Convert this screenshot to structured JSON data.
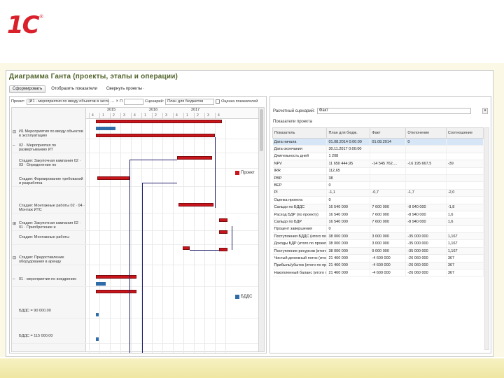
{
  "logo": {
    "text": "1С",
    "mark": "®"
  },
  "window": {
    "title": "Диаграмма Ганта (проекты, этапы и операции)"
  },
  "toolbar": {
    "btn1": "Сформировать",
    "btn2": "Отобразить показатели",
    "btn3": "Свернуть проекты ·"
  },
  "filters": {
    "f1_label": "Проект:",
    "f1_value": "(И1 - мероприятия по вводу объектов в эксплу.",
    "f2_label": "П",
    "f3_label": "Сценарий:",
    "f3_value": "План для бюджетов",
    "f4_label": "Оценка показателей"
  },
  "timeline": {
    "years": [
      "2015",
      "2016",
      "2017"
    ],
    "quarters": [
      "4",
      "1",
      "2",
      "3",
      "4",
      "1",
      "2",
      "3",
      "4",
      "1",
      "2",
      "3",
      "4"
    ]
  },
  "gantt_rows": [
    {
      "label": "И1 Мероприятия по вводу объектов в эксплуатацию",
      "exp": "⊟"
    },
    {
      "label": "02 · Мероприятия по развертыванию ИТ",
      "exp": "–"
    },
    {
      "label": "Стадия: Закупочная кампания 02 · 03 · Определение по",
      "exp": ""
    },
    {
      "label": "Стадия: Формирование требований и разработка",
      "exp": ""
    },
    {
      "label": "Стадия: Монтажные работы 02 · 04 · Монтаж ИТС",
      "exp": ""
    },
    {
      "label": "Стадия: Закупочная кампания 02 · 01 · Приобретение и",
      "exp": "⊞"
    },
    {
      "label": "Стадия: Монтажные работы",
      "exp": ""
    },
    {
      "label": "Стадия: Предоставление оборудования в аренду",
      "exp": "⊟"
    },
    {
      "label": "01 · мероприятия по внедрению",
      "exp": "–"
    },
    {
      "label": "БДДС = 90 000.00",
      "exp": ""
    },
    {
      "label": "БДДС = 115 000.00",
      "exp": ""
    }
  ],
  "legend": {
    "project": "Проект",
    "bdds": "БДДС"
  },
  "rpanel": {
    "calc_label": "Расчетный сценарий:",
    "calc_value": "Факт",
    "show_label": "Показатели проекта"
  },
  "table": {
    "headers": [
      "Показатель",
      "План для бюдж.",
      "Факт",
      "Отклонение",
      "Соотношение"
    ],
    "rows": [
      [
        "Дата начала",
        "01.08.2014 0:00:00",
        "01.08.2014",
        "0",
        ""
      ],
      [
        "Дата окончания",
        "30.11.2017 0:00:00",
        "",
        "",
        ""
      ],
      [
        "Длительность дней",
        "1 208",
        "",
        "",
        ""
      ],
      [
        "NPV",
        "11 650 444,95",
        "-14 545 762,…",
        "-16 195 667,5",
        "-39"
      ],
      [
        "IRR",
        "112,65",
        "",
        "",
        ""
      ],
      [
        "PBP",
        "38",
        "",
        "",
        ""
      ],
      [
        "BEP",
        "0",
        "",
        "",
        ""
      ],
      [
        "PI",
        "-1,1",
        "-0,7",
        "-1,7",
        "-2,0"
      ],
      [
        "Оценка проекта",
        "0",
        "",
        "",
        ""
      ],
      [
        "Сальдо по БДДС",
        "16 540 000",
        "7 600 000",
        "-8 940 000",
        "-1,8"
      ],
      [
        "Расход БДР (по проекту)",
        "16 540 000",
        "7 600 000",
        "-8 940 000",
        "1,6"
      ],
      [
        "Сальдо по БДР",
        "16 540 000",
        "7 600 000",
        "-8 940 000",
        "1,6"
      ],
      [
        "Процент завершения",
        "0",
        "",
        "",
        ""
      ],
      [
        "Поступления БДДС (итого по п…",
        "38 000 000",
        "3 000 000",
        "-35 000 000",
        "1,167"
      ],
      [
        "Доходы БДР (итого по проекту)",
        "38 000 000",
        "3 000 000",
        "-35 000 000",
        "1,167"
      ],
      [
        "Поступление ресурсов (итого по…",
        "38 000 000",
        "9 000 000",
        "-35 000 000",
        "1,167"
      ],
      [
        "Чистый денежный поток (итого…",
        "21 460 000",
        "-4 600 000",
        "-26 060 000",
        "367"
      ],
      [
        "Прибыль/убыток (итого по проек…",
        "21 460 000",
        "-4 600 000",
        "-26 060 000",
        "367"
      ],
      [
        "Накопленный баланс (итого по…",
        "21 460 000",
        "-4 600 000",
        "-26 060 000",
        "367"
      ]
    ]
  },
  "colors": {
    "title": "#4f6228",
    "bar_red": "#c8151c",
    "bar_blue": "#2f6da8",
    "logo_red": "#d9202b"
  },
  "icons": [
    "search-icon",
    "calendar-icon",
    "chevron-down-icon",
    "plus-icon",
    "minus-icon",
    "scroll-arrow-icon"
  ]
}
